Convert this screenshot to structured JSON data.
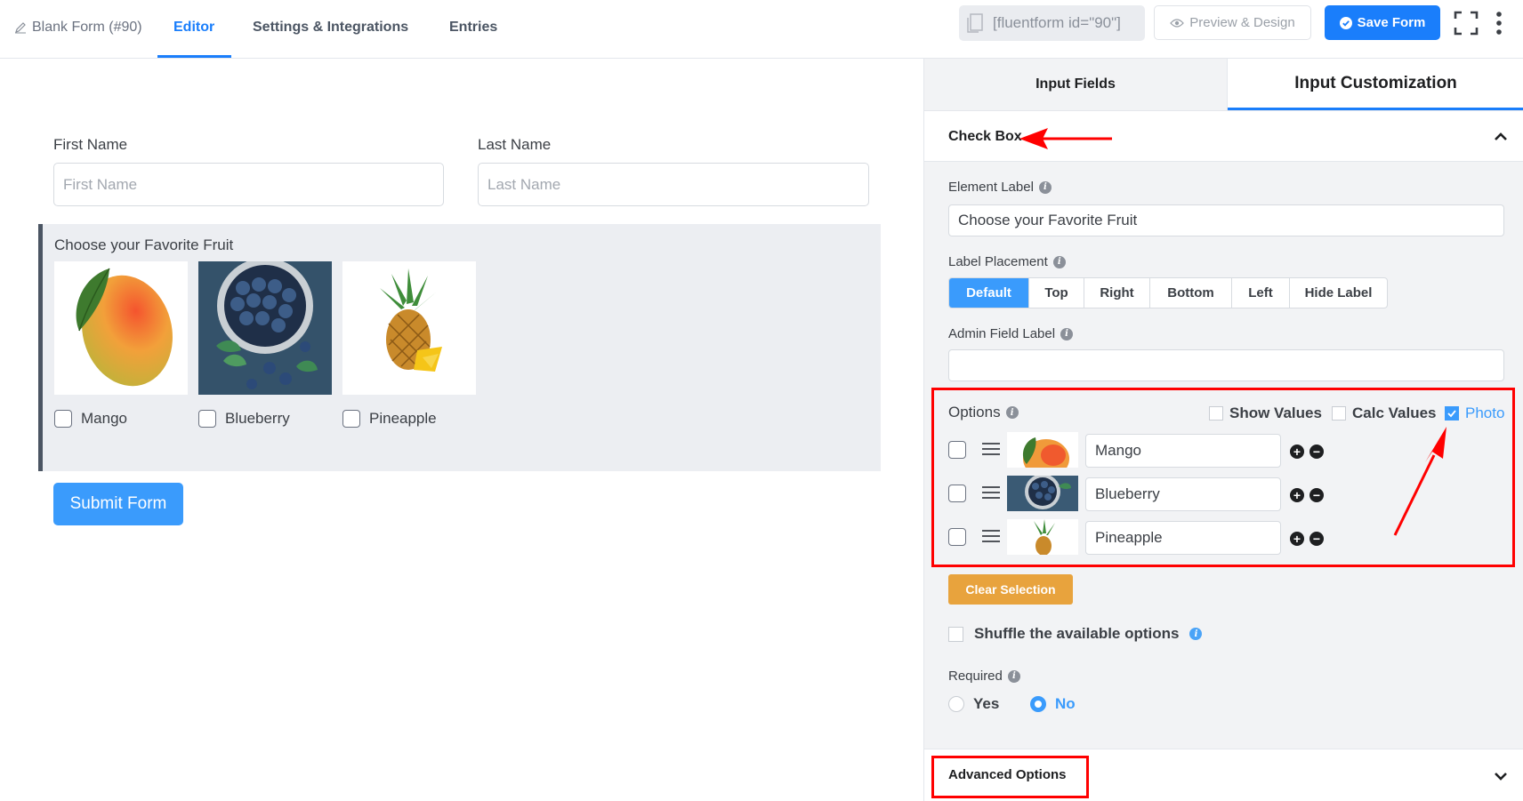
{
  "header": {
    "form_title": "Blank Form (#90)",
    "tabs": [
      {
        "label": "Editor",
        "active": true
      },
      {
        "label": "Settings & Integrations",
        "active": false
      },
      {
        "label": "Entries",
        "active": false
      }
    ],
    "shortcode": "[fluentform id=\"90\"]",
    "preview_label": "Preview & Design",
    "save_label": "Save Form"
  },
  "editor": {
    "first_name": {
      "label": "First Name",
      "placeholder": "First Name"
    },
    "last_name": {
      "label": "Last Name",
      "placeholder": "Last Name"
    },
    "fruit_question": "Choose your Favorite Fruit",
    "fruits": [
      "Mango",
      "Blueberry",
      "Pineapple"
    ],
    "submit_label": "Submit Form"
  },
  "panel": {
    "tabs": [
      {
        "label": "Input Fields",
        "active": false
      },
      {
        "label": "Input Customization",
        "active": true
      }
    ],
    "section_title": "Check Box",
    "element_label": {
      "label": "Element Label",
      "value": "Choose your Favorite Fruit"
    },
    "label_placement": {
      "label": "Label Placement",
      "options": [
        "Default",
        "Top",
        "Right",
        "Bottom",
        "Left",
        "Hide Label"
      ],
      "selected": "Default"
    },
    "admin_field_label": {
      "label": "Admin Field Label",
      "value": ""
    },
    "options": {
      "label": "Options",
      "show_values_label": "Show Values",
      "calc_values_label": "Calc Values",
      "photo_label": "Photo",
      "photo_checked": true,
      "items": [
        "Mango",
        "Blueberry",
        "Pineapple"
      ]
    },
    "clear_selection_label": "Clear Selection",
    "shuffle_label": "Shuffle the available options",
    "required": {
      "label": "Required",
      "yes": "Yes",
      "no": "No",
      "selected": "No"
    },
    "advanced_options_label": "Advanced Options"
  },
  "colors": {
    "accent": "#1a7efb",
    "clear_button": "#e8a33d",
    "annotation_red": "#ff0000"
  },
  "icons": [
    "edit-icon",
    "document-icon",
    "eye-icon",
    "check-circle-icon",
    "fullscreen-icon",
    "kebab-icon",
    "chevron-up-icon",
    "chevron-down-icon",
    "info-icon",
    "drag-handle-icon",
    "plus-circle-icon",
    "minus-circle-icon"
  ]
}
